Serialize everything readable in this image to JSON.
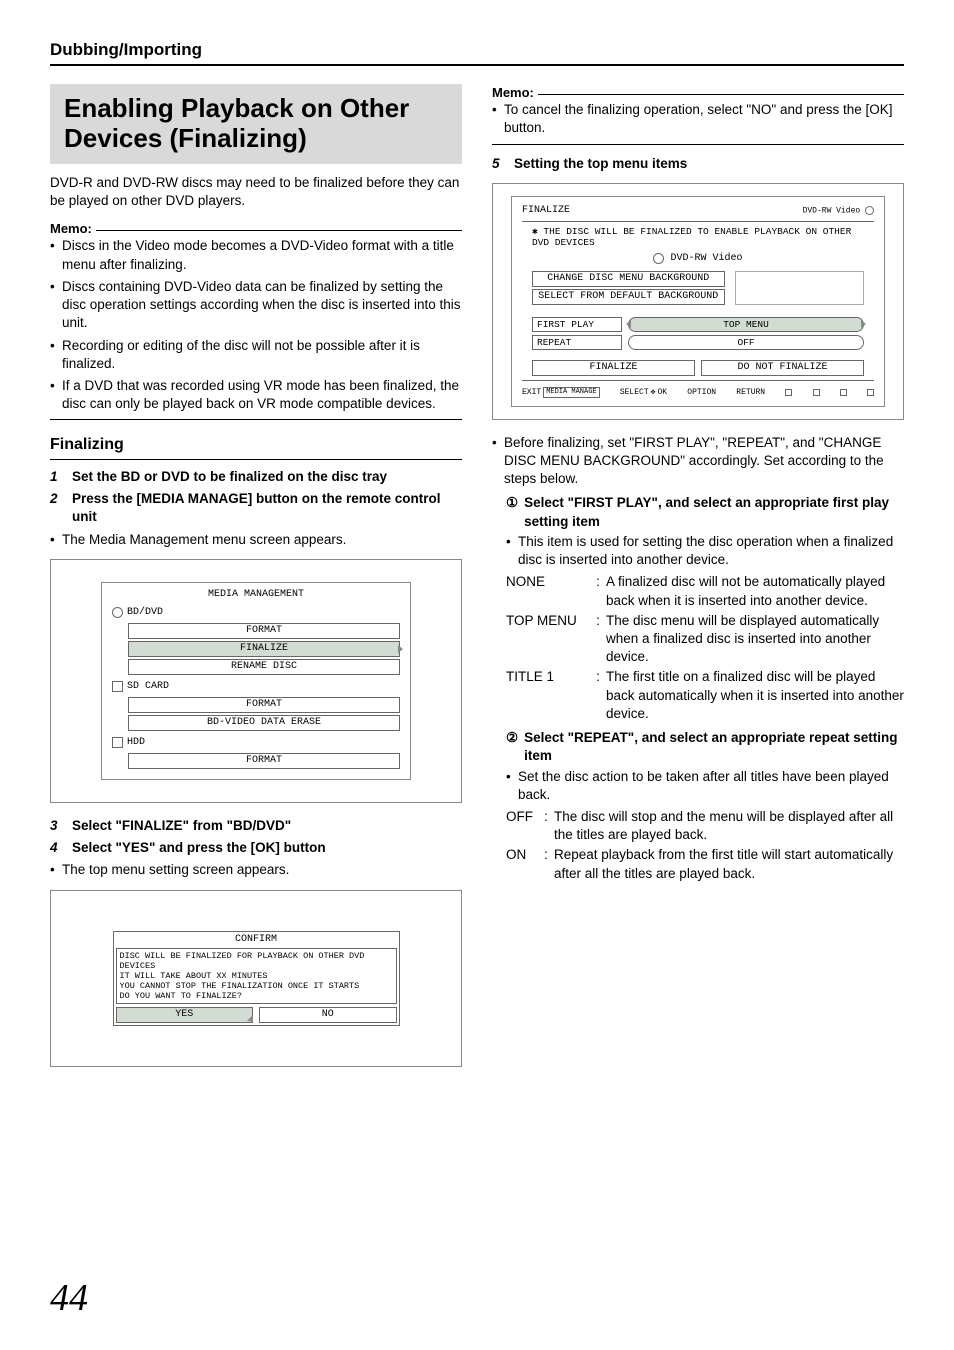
{
  "page_number": "44",
  "header": "Dubbing/Importing",
  "title": "Enabling Playback on Other Devices (Finalizing)",
  "intro": "DVD-R and DVD-RW discs may need to be finalized before they can be played on other DVD players.",
  "memo_label": "Memo:",
  "memo1": [
    "Discs in the Video mode becomes a DVD-Video format with a title menu after finalizing.",
    "Discs containing DVD-Video data can be finalized by setting the disc operation settings according when the disc is inserted into this unit.",
    "Recording or editing of the disc will not be possible after it is finalized.",
    "If a DVD that was recorded using VR mode has been finalized, the disc can only be played back on VR mode compatible devices."
  ],
  "section_finalizing": "Finalizing",
  "steps": {
    "s1": {
      "n": "1",
      "t": "Set the BD or DVD to be finalized on the disc tray"
    },
    "s2": {
      "n": "2",
      "t": "Press the [MEDIA MANAGE] button on the remote control unit"
    },
    "s2_note": "The Media Management menu screen appears.",
    "s3": {
      "n": "3",
      "t": "Select \"FINALIZE\" from \"BD/DVD\""
    },
    "s4": {
      "n": "4",
      "t": "Select \"YES\" and press the [OK] button"
    },
    "s4_note": "The top menu setting screen appears.",
    "s5": {
      "n": "5",
      "t": "Setting the top menu items"
    }
  },
  "menu_fig": {
    "title": "MEDIA MANAGEMENT",
    "g1": "BD/DVD",
    "g1_items": [
      "FORMAT",
      "FINALIZE",
      "RENAME DISC"
    ],
    "g2": "SD CARD",
    "g2_items": [
      "FORMAT",
      "BD-VIDEO DATA ERASE"
    ],
    "g3": "HDD",
    "g3_items": [
      "FORMAT"
    ]
  },
  "confirm_fig": {
    "title": "CONFIRM",
    "lines": [
      "DISC WILL BE FINALIZED FOR PLAYBACK ON OTHER DVD DEVICES",
      "IT WILL TAKE ABOUT XX MINUTES",
      "YOU CANNOT STOP THE FINALIZATION ONCE IT STARTS",
      "DO YOU WANT TO FINALIZE?"
    ],
    "yes": "YES",
    "no": "NO"
  },
  "right_memo": [
    "To cancel the finalizing operation, select \"NO\" and press the [OK] button."
  ],
  "finalize_fig": {
    "title": "FINALIZE",
    "badge": "DVD-RW Video",
    "top_note": "THE DISC WILL BE FINALIZED TO ENABLE PLAYBACK ON OTHER DVD DEVICES",
    "disc_label": "DVD-RW Video",
    "bg_btn1": "CHANGE DISC MENU BACKGROUND",
    "bg_btn2": "SELECT FROM DEFAULT BACKGROUND",
    "first_play": {
      "label": "FIRST PLAY",
      "value": "TOP MENU"
    },
    "repeat": {
      "label": "REPEAT",
      "value": "OFF"
    },
    "finalize_btn": "FINALIZE",
    "no_finalize_btn": "DO NOT FINALIZE",
    "footer": {
      "exit": "EXIT",
      "back": "SELECT",
      "ok": "OK",
      "option": "OPTION",
      "return": "RETURN"
    }
  },
  "prep_bullet": "Before finalizing, set \"FIRST PLAY\", \"REPEAT\", and \"CHANGE DISC MENU BACKGROUND\" accordingly. Set according to the steps below.",
  "circ1": {
    "n": "①",
    "t": "Select \"FIRST PLAY\", and select an appropriate first play setting item"
  },
  "circ1_note": "This item is used for setting the disc operation when a finalized disc is inserted into another device.",
  "defs1": {
    "NONE": "A finalized disc will not be automatically played back when it is inserted into another device.",
    "TOP MENU": "The disc menu will be displayed automatically when a finalized disc is inserted into another device.",
    "TITLE 1": "The first title on a finalized disc will be played back automatically when it is inserted into another device."
  },
  "circ2": {
    "n": "②",
    "t": "Select \"REPEAT\", and select an appropriate repeat setting item"
  },
  "circ2_note": "Set the disc action to be taken after all titles have been played back.",
  "defs2": {
    "OFF": "The disc will stop and the menu will be displayed after all the titles are played back.",
    "ON": "Repeat playback from the first title will start automatically after all the titles are played back."
  }
}
